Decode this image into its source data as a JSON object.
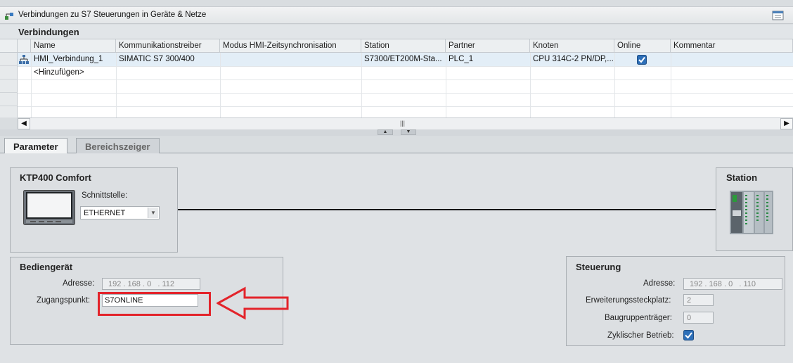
{
  "window": {
    "title": "Verbindungen zu S7 Steuerungen in Geräte & Netze"
  },
  "section": {
    "title": "Verbindungen"
  },
  "table": {
    "columns": [
      "Name",
      "Kommunikationstreiber",
      "Modus HMI-Zeitsynchronisation",
      "Station",
      "Partner",
      "Knoten",
      "Online",
      "Kommentar"
    ],
    "rows": [
      {
        "name": "HMI_Verbindung_1",
        "treiber": "SIMATIC S7 300/400",
        "modus": "",
        "station": "S7300/ET200M-Sta...",
        "partner": "PLC_1",
        "knoten": "CPU 314C-2 PN/DP,...",
        "online": true,
        "kommentar": ""
      }
    ],
    "add_row": "<Hinzufügen>"
  },
  "tabs": {
    "parameter": "Parameter",
    "bereichszeiger": "Bereichszeiger"
  },
  "device_panel": {
    "title": "KTP400 Comfort",
    "interface_label": "Schnittstelle:",
    "interface_value": "ETHERNET"
  },
  "station_panel": {
    "title": "Station"
  },
  "bediengeraet": {
    "title": "Bediengerät",
    "address_label": "Adresse:",
    "ip": [
      "192",
      "168",
      "0",
      "112"
    ],
    "access_label": "Zugangspunkt:",
    "access_value": "S7ONLINE"
  },
  "steuerung": {
    "title": "Steuerung",
    "address_label": "Adresse:",
    "ip": [
      "192",
      "168",
      "0",
      "110"
    ],
    "slot_label": "Erweiterungssteckplatz:",
    "slot_value": "2",
    "rack_label": "Baugruppenträger:",
    "rack_value": "0",
    "cyclic_label": "Zyklischer Betrieb:",
    "cyclic_checked": true
  },
  "annotation": {
    "highlight_color": "#e3242b"
  }
}
